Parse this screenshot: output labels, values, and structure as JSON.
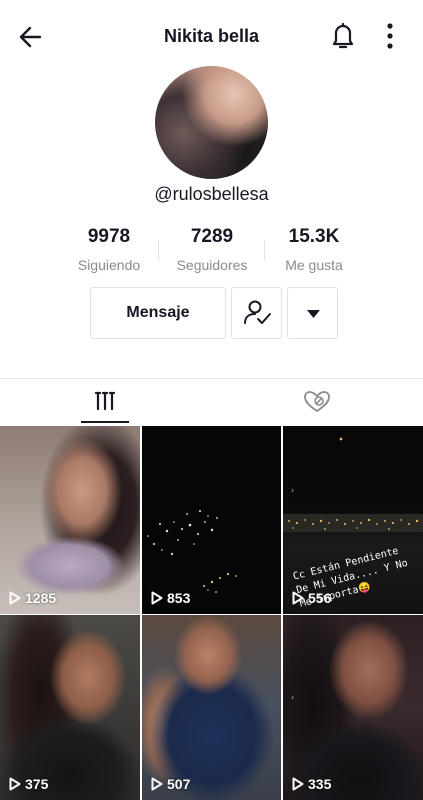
{
  "header": {
    "title": "Nikita bella",
    "back_icon": "arrow-left-icon",
    "bell_icon": "bell-icon",
    "more_icon": "more-vertical-icon"
  },
  "profile": {
    "handle": "@rulosbellesa",
    "stats": [
      {
        "value": "9978",
        "label": "Siguiendo"
      },
      {
        "value": "7289",
        "label": "Seguidores"
      },
      {
        "value": "15.3K",
        "label": "Me gusta"
      }
    ]
  },
  "actions": {
    "message_label": "Mensaje",
    "following_icon": "user-check-icon",
    "dropdown_icon": "caret-down-icon"
  },
  "tabs": [
    {
      "name": "videos",
      "icon": "grid-icon",
      "active": true
    },
    {
      "name": "liked",
      "icon": "heart-hidden-icon",
      "active": false
    }
  ],
  "videos": [
    {
      "views": "1285"
    },
    {
      "views": "853"
    },
    {
      "views": "556",
      "caption": "Cc Están Pendiente De Mi Vida.... Y No Me Importa😝"
    },
    {
      "views": "375"
    },
    {
      "views": "507"
    },
    {
      "views": "335"
    }
  ],
  "colors": {
    "text_primary": "#161823",
    "text_secondary": "#8a8b91",
    "border": "#e1e1e2"
  }
}
